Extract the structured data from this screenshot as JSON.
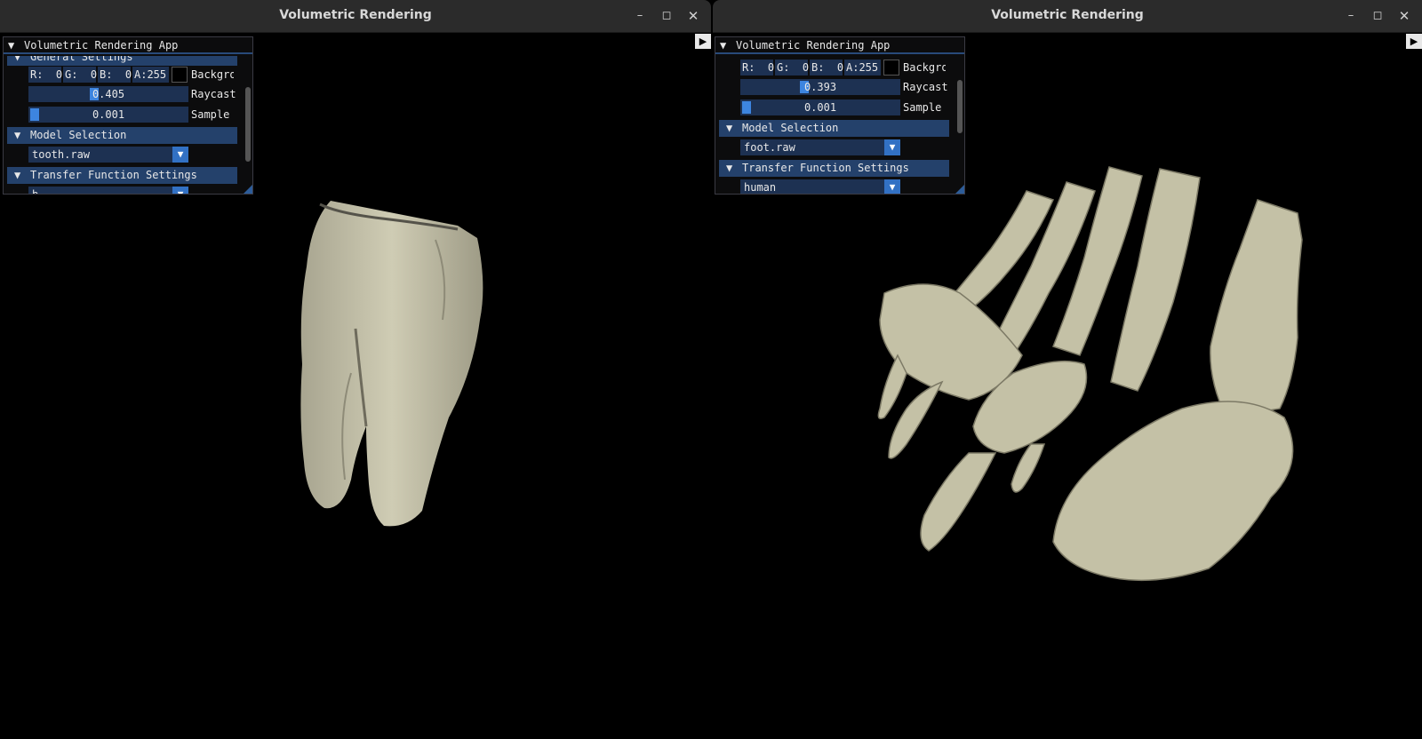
{
  "windows": [
    {
      "title": "Volumetric Rendering",
      "panel": {
        "title": "Volumetric Rendering App",
        "general_header": "General Settings",
        "rgba": {
          "r": "R:  0",
          "g": "G:  0",
          "b": "B:  0",
          "a": "A:255"
        },
        "background_label": "Backgrou",
        "raycast_value": "0.405",
        "raycast_fraction": 0.405,
        "raycast_label": "Raycast",
        "sample_value": "0.001",
        "sample_label": "Sample",
        "model_header": "Model Selection",
        "model_value": "tooth.raw",
        "transfer_header": "Transfer Function Settings",
        "transfer_value": "b"
      },
      "model": "tooth"
    },
    {
      "title": "Volumetric Rendering",
      "panel": {
        "title": "Volumetric Rendering App",
        "general_header": "",
        "rgba": {
          "r": "R:  0",
          "g": "G:  0",
          "b": "B:  0",
          "a": "A:255"
        },
        "background_label": "Backgrou",
        "raycast_value": "0.393",
        "raycast_fraction": 0.393,
        "raycast_label": "Raycast",
        "sample_value": "0.001",
        "sample_label": "Sample",
        "model_header": "Model Selection",
        "model_value": "foot.raw",
        "transfer_header": "Transfer Function Settings",
        "transfer_value": "human"
      },
      "model": "foot"
    }
  ],
  "icons": {
    "minimize": "minimize-icon",
    "maximize": "maximize-icon",
    "close": "close-icon",
    "collapse": "triangle-down-icon",
    "expand_sidebar": "triangle-right-icon"
  },
  "colors": {
    "bone": "#c9c6ad",
    "slider_grab": "#3d85e0",
    "header": "#24416b",
    "frame": "#1d3152"
  }
}
